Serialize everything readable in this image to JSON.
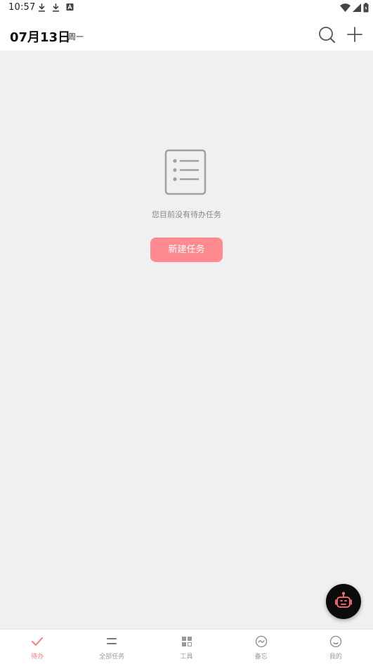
{
  "status_bar": {
    "time": "10:57"
  },
  "header": {
    "date": "07月13日",
    "weekday": "周一"
  },
  "empty_state": {
    "message": "您目前没有待办任务",
    "new_task_label": "新建任务"
  },
  "bottom_nav": {
    "items": [
      {
        "label": "待办",
        "icon": "check-icon",
        "active": true
      },
      {
        "label": "全部任务",
        "icon": "list-icon",
        "active": false
      },
      {
        "label": "工具",
        "icon": "grid-icon",
        "active": false
      },
      {
        "label": "备忘",
        "icon": "memo-icon",
        "active": false
      },
      {
        "label": "我的",
        "icon": "smile-icon",
        "active": false
      }
    ]
  },
  "colors": {
    "accent": "#ff8a8f",
    "active_nav": "#ff7a80",
    "background": "#f0f0f0",
    "fab": "#0c0c0c"
  }
}
